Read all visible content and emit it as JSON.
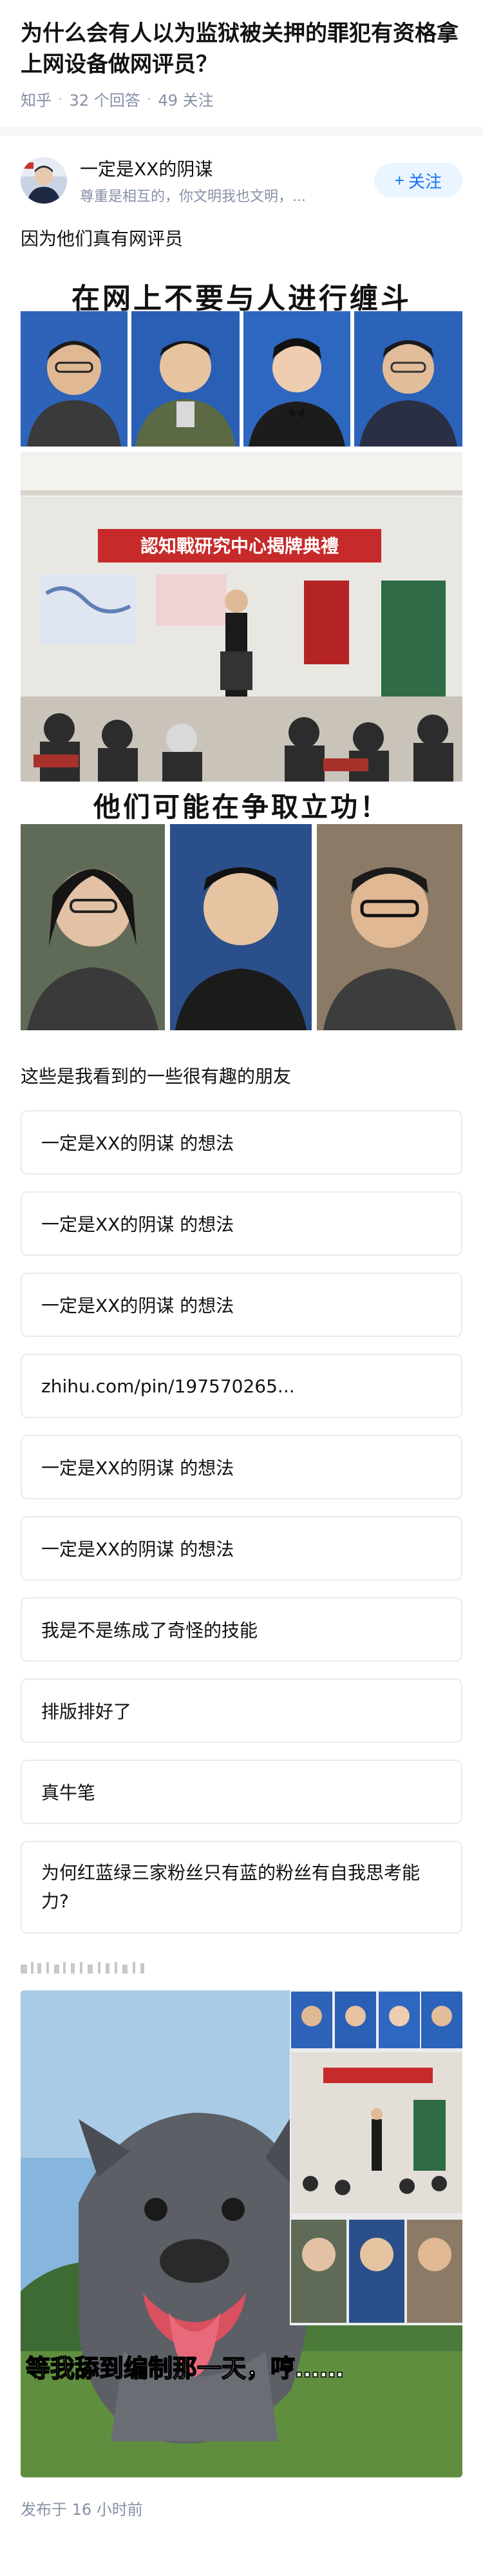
{
  "question": {
    "title": "为什么会有人以为监狱被关押的罪犯有资格拿上网设备做网评员？",
    "source": "知乎",
    "answers": "32 个回答",
    "followers": "49 关注"
  },
  "author": {
    "name": "一定是XX的阴谋",
    "bio": "尊重是相互的，你文明我也文明，...",
    "follow_label": "关注",
    "follow_icon": "plus-icon"
  },
  "answer": {
    "intro": "因为他们真有网评员",
    "meme1": {
      "top_caption": "在网上不要与人进行缠斗",
      "sign_text": "認知戰研究中心揭牌典禮",
      "bottom_caption": "他们可能在争取立功！"
    },
    "list_intro": "这些是我看到的一些很有趣的朋友",
    "links": [
      "一定是XX的阴谋 的想法",
      "一定是XX的阴谋 的想法",
      "一定是XX的阴谋 的想法",
      "zhihu.com/pin/197570265...",
      "一定是XX的阴谋 的想法",
      "一定是XX的阴谋 的想法",
      "我是不是练成了奇怪的技能",
      "排版排好了",
      "真牛笔",
      "为何红蓝绿三家粉丝只有蓝的粉丝有自我思考能力?"
    ],
    "meme2": {
      "caption": "等我舔到编制那一天，哼……"
    }
  },
  "footer": {
    "published": "发布于  16 小时前"
  }
}
